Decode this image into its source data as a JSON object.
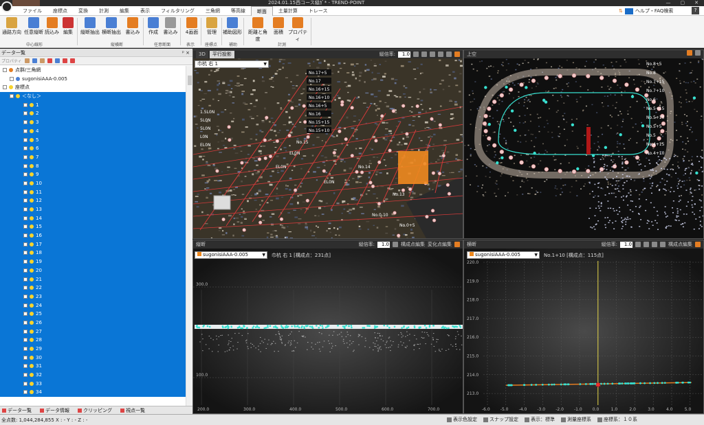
{
  "window": {
    "title": "2024.01.15西コース縦ｶﾞ* - TREND-POINT",
    "controls": [
      "—",
      "▢",
      "✕"
    ]
  },
  "menu": {
    "tabs": [
      "ファイル",
      "座標点",
      "変換",
      "計測",
      "編集",
      "表示",
      "フィルタリング",
      "三角網",
      "等高線",
      "断面",
      "土量計算",
      "トレース"
    ],
    "active_index": 9,
    "help_label": "ヘルプ・FAQ検索",
    "help_button": "?"
  },
  "ribbon": {
    "buttons": [
      "通路方向",
      "任意縦断",
      "読込み",
      "編集",
      "縦断抽出",
      "横断抽出",
      "書込み",
      "作成",
      "書込み",
      "4画面",
      "管理",
      "補助図形",
      "距離と角度",
      "面積",
      "プロパティ"
    ],
    "groups": [
      "中心線形",
      "縦横断",
      "任意断面",
      "表示",
      "座標点",
      "補助",
      "計測"
    ]
  },
  "left_panel": {
    "title": "データ一覧",
    "pin": "ᵖ ×",
    "toolbar_hint": "プロパティ",
    "tree": {
      "pointcloud_group": "点群/三角網",
      "pointcloud_item": "sugonisiAAA-0.005",
      "coord_group": "座標点",
      "coord_none": "＜なし＞",
      "points": [
        "1",
        "2",
        "3",
        "4",
        "5",
        "6",
        "7",
        "8",
        "9",
        "10",
        "11",
        "12",
        "13",
        "14",
        "15",
        "16",
        "17",
        "18",
        "19",
        "20",
        "21",
        "22",
        "23",
        "24",
        "25",
        "26",
        "27",
        "28",
        "29",
        "30",
        "31",
        "32",
        "33",
        "34"
      ]
    },
    "bottom_tabs": [
      "データ一覧",
      "データ情報",
      "クリッピング",
      "視点一覧"
    ]
  },
  "view_3d": {
    "tabs": [
      "3D",
      "平行投影"
    ],
    "scale_label": "縦倍率:",
    "scale_value": "1.0",
    "combo": "巾杭 右 1",
    "stations": [
      "No.17+5",
      "No.17",
      "No.16+15",
      "No.16+10",
      "No.16+5",
      "No.16",
      "No.15+15",
      "No.15+10"
    ],
    "labels": [
      "No.15",
      "No.14",
      "No.13",
      "1.5L0N",
      "5L0N",
      "5L0N",
      "L0N",
      "EL0N",
      "EL0N",
      "EL0N",
      "EL0N",
      "No.0-10",
      "No.0+5"
    ]
  },
  "view_top": {
    "title": "上空",
    "labels": [
      "No.8+5",
      "No.8",
      "No.7+15",
      "No.7+10",
      "No.6",
      "No.5+15",
      "No.5+10",
      "No.5+5",
      "No.5",
      "No.4+15",
      "No.4+10"
    ]
  },
  "view_long": {
    "title": "縦断",
    "scale_label": "縦倍率:",
    "scale_value": "1.0",
    "tools": [
      "構成点編集",
      "変化点編集"
    ],
    "combo": "sugonisiAAA-0.005",
    "info": "巾杭 右 1 [構成点：231点]",
    "y_ticks": [
      "300.0",
      "100.0"
    ],
    "x_ticks": [
      "200.0",
      "300.0",
      "400.0",
      "500.0",
      "600.0",
      "700.0"
    ]
  },
  "view_cross": {
    "title": "横断",
    "scale_label": "縦倍率:",
    "scale_value": "1.0",
    "tools": [
      "構成点編集"
    ],
    "combo": "sugonisiAAA-0.005",
    "info": "No.1+10 [構成点：115点]",
    "y_ticks": [
      "220.0",
      "219.0",
      "218.0",
      "217.0",
      "216.0",
      "215.0",
      "214.0",
      "213.0"
    ],
    "x_ticks": [
      "-6.0",
      "-5.0",
      "-4.0",
      "-3.0",
      "-2.0",
      "-1.0",
      "0.0",
      "1.0",
      "2.0",
      "3.0",
      "4.0",
      "5.0",
      "6.0"
    ]
  },
  "status": {
    "left": "全点数: 1,044,284,855  X : -  Y : -  Z : -",
    "right": [
      "表示色設定",
      "スナップ設定",
      "表示：標準",
      "測量座標系",
      "座標系：１０系"
    ]
  },
  "colors": {
    "selection": "#0a76d6",
    "accent": "#e47d22",
    "cyan": "#38e0d0",
    "point_yellow": "#f7d32c"
  },
  "icons": {
    "logo": "trend-point-logo",
    "help": "help-search-icon"
  }
}
